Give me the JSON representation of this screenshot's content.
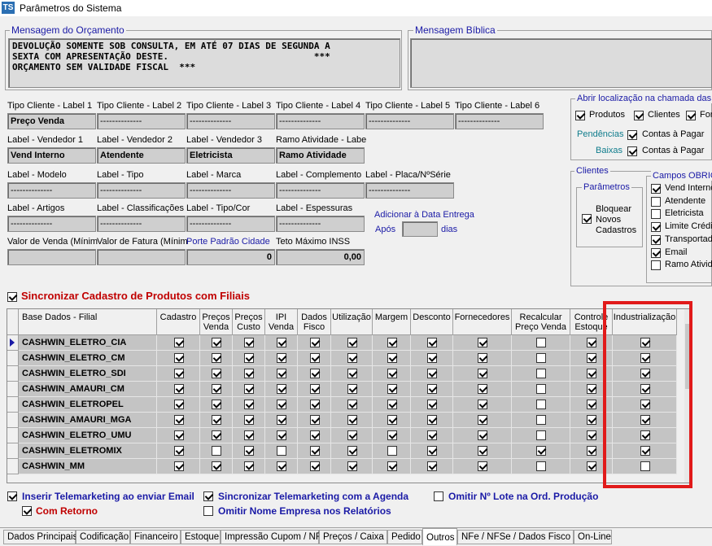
{
  "window": {
    "title": "Parâmetros do Sistema",
    "icon": "TS"
  },
  "mensagem_orcamento": {
    "legend": "Mensagem do Orçamento",
    "text": "DEVOLUÇÃO SOMENTE SOB CONSULTA, EM ATÉ 07 DIAS DE SEGUNDA A\nSEXTA COM APRESENTAÇÃO DESTE.                           ***\nORÇAMENTO SEM VALIDADE FISCAL  ***"
  },
  "mensagem_biblica": {
    "legend": "Mensagem Bíblica",
    "text": ""
  },
  "fields": [
    {
      "label": "Tipo Cliente - Label 1",
      "value": "Preço Venda"
    },
    {
      "label": "Tipo Cliente - Label 2",
      "value": "--------------"
    },
    {
      "label": "Tipo Cliente - Label 3",
      "value": "--------------"
    },
    {
      "label": "Tipo Cliente - Label 4",
      "value": "--------------"
    },
    {
      "label": "Tipo Cliente - Label 5",
      "value": "--------------"
    },
    {
      "label": "Tipo Cliente - Label 6",
      "value": "--------------"
    },
    {
      "label": "Label - Vendedor 1",
      "value": "Vend Interno"
    },
    {
      "label": "Label - Vendedor 2",
      "value": "Atendente"
    },
    {
      "label": "Label - Vendedor 3",
      "value": "Eletricista"
    },
    {
      "label": "Ramo Atividade - Label",
      "value": "Ramo Atividade"
    },
    {
      "label": "Label - Modelo",
      "value": "--------------"
    },
    {
      "label": "Label - Tipo",
      "value": "--------------"
    },
    {
      "label": "Label - Marca",
      "value": "--------------"
    },
    {
      "label": "Label - Complemento",
      "value": "--------------"
    },
    {
      "label": "Label - Placa/NºSérie",
      "value": "--------------"
    },
    {
      "label": "Label - Artigos",
      "value": "--------------"
    },
    {
      "label": "Label - Classificações",
      "value": "--------------"
    },
    {
      "label": "Label - Tipo/Cor",
      "value": "--------------"
    },
    {
      "label": "Label - Espessuras",
      "value": "--------------"
    },
    {
      "label": "Valor de Venda (Mínimo)",
      "value": ""
    },
    {
      "label": "Valor de Fatura (Mínimo)",
      "value": ""
    },
    {
      "label": "Porte Padrão Cidade",
      "value": "0"
    },
    {
      "label": "Teto Máximo INSS",
      "value": "0,00"
    }
  ],
  "data_entrega": {
    "label": "Adicionar à Data Entrega",
    "apos": "Após",
    "dias": "dias",
    "value": ""
  },
  "abrir_localizacao": {
    "legend": "Abrir localização na chamada das tel",
    "items": [
      {
        "label": "Produtos",
        "checked": true
      },
      {
        "label": "Clientes",
        "checked": true
      },
      {
        "label": "Forn",
        "checked": true
      }
    ],
    "pendencias": {
      "label": "Pendências",
      "check_label": "Contas à Pagar",
      "checked": true
    },
    "baixas": {
      "label": "Baixas",
      "check_label": "Contas à Pagar",
      "checked": true
    }
  },
  "clientes": {
    "legend": "Clientes",
    "parametros": {
      "legend": "Parâmetros",
      "label": "Bloquear Novos Cadastros",
      "checked": true
    },
    "campos": {
      "legend": "Campos OBRIGA",
      "items": [
        {
          "label": "Vend Interno",
          "checked": true
        },
        {
          "label": "Atendente",
          "checked": false
        },
        {
          "label": "Eletricista",
          "checked": false
        },
        {
          "label": "Limite Crédito",
          "checked": true
        },
        {
          "label": "Transportadora",
          "checked": true
        },
        {
          "label": "Email",
          "checked": true
        },
        {
          "label": "Ramo Atividade",
          "checked": false
        }
      ]
    }
  },
  "sync_produtos": {
    "label": "Sincronizar Cadastro de Produtos com Filiais",
    "checked": true
  },
  "grid": {
    "columns": [
      "Base Dados - Filial",
      "Cadastro",
      "Preços\nVenda",
      "Preços\nCusto",
      "IPI\nVenda",
      "Dados\nFisco",
      "Utilização",
      "Margem",
      "Desconto",
      "Fornecedores",
      "Recalcular\nPreço Venda",
      "Controle\nEstoque",
      "Industrialização"
    ],
    "rows": [
      {
        "name": "CASHWIN_ELETRO_CIA",
        "checks": [
          1,
          1,
          1,
          1,
          1,
          1,
          1,
          1,
          1,
          0,
          1,
          1
        ]
      },
      {
        "name": "CASHWIN_ELETRO_CM",
        "checks": [
          1,
          1,
          1,
          1,
          1,
          1,
          1,
          1,
          1,
          0,
          1,
          1
        ]
      },
      {
        "name": "CASHWIN_ELETRO_SDI",
        "checks": [
          1,
          1,
          1,
          1,
          1,
          1,
          1,
          1,
          1,
          0,
          1,
          1
        ]
      },
      {
        "name": "CASHWIN_AMAURI_CM",
        "checks": [
          1,
          1,
          1,
          1,
          1,
          1,
          1,
          1,
          1,
          0,
          1,
          1
        ]
      },
      {
        "name": "CASHWIN_ELETROPEL",
        "checks": [
          1,
          1,
          1,
          1,
          1,
          1,
          1,
          1,
          1,
          0,
          1,
          1
        ]
      },
      {
        "name": "CASHWIN_AMAURI_MGA",
        "checks": [
          1,
          1,
          1,
          1,
          1,
          1,
          1,
          1,
          1,
          0,
          1,
          1
        ]
      },
      {
        "name": "CASHWIN_ELETRO_UMU",
        "checks": [
          1,
          1,
          1,
          1,
          1,
          1,
          1,
          1,
          1,
          0,
          1,
          1
        ]
      },
      {
        "name": "CASHWIN_ELETROMIX",
        "checks": [
          1,
          0,
          1,
          0,
          1,
          1,
          0,
          1,
          1,
          1,
          1,
          1
        ]
      },
      {
        "name": "CASHWIN_MM",
        "checks": [
          1,
          1,
          1,
          1,
          1,
          1,
          1,
          1,
          1,
          0,
          1,
          0
        ]
      }
    ]
  },
  "bottom_options": [
    {
      "label": "Inserir Telemarketing ao enviar Email",
      "checked": true
    },
    {
      "label": "Com Retorno",
      "checked": true
    },
    {
      "label": "Sincronizar Telemarketing com a Agenda",
      "checked": true
    },
    {
      "label": "Omitir Nome Empresa nos Relatórios",
      "checked": false
    },
    {
      "label": "Omitir Nº Lote na Ord. Produção",
      "checked": false
    }
  ],
  "tabs": [
    "Dados Principais",
    "Codificação",
    "Financeiro",
    "Estoque",
    "Impressão Cupom / NF",
    "Preços / Caixa",
    "Pedido",
    "Outros",
    "NFe / NFSe / Dados Fisco",
    "On-Line"
  ],
  "active_tab": "Outros"
}
